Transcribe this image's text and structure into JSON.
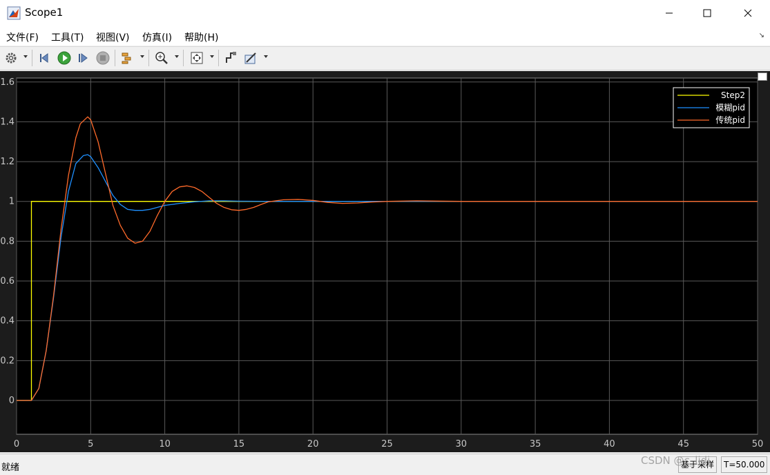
{
  "window": {
    "title": "Scope1"
  },
  "menu": {
    "items": [
      "文件(F)",
      "工具(T)",
      "视图(V)",
      "仿真(I)",
      "帮助(H)"
    ]
  },
  "toolbar": {
    "icons": [
      "gear-icon",
      "step-back-icon",
      "run-icon",
      "step-forward-icon",
      "stop-icon",
      "signal-select-icon",
      "zoom-in-icon",
      "fit-view-icon",
      "cursor-icon",
      "measure-icon"
    ]
  },
  "status": {
    "text": "就绪",
    "mode": "基于采样",
    "time": "T=50.000"
  },
  "watermark": "CSDN @c_lidi",
  "colors": {
    "plot_bg": "#000000",
    "grid": "#5a5a5a",
    "step": "#ffff00",
    "fuzzy": "#1e90ff",
    "classic": "#ff6a2a"
  },
  "chart_data": {
    "type": "line",
    "xlim": [
      0,
      50
    ],
    "ylim": [
      -0.17,
      1.62
    ],
    "xticks": [
      0,
      5,
      10,
      15,
      20,
      25,
      30,
      35,
      40,
      45,
      50
    ],
    "yticks": [
      0,
      0.2,
      0.4,
      0.6,
      0.8,
      1,
      1.2,
      1.4,
      1.6
    ],
    "xtick_labels": [
      "0",
      "5",
      "10",
      "15",
      "20",
      "25",
      "30",
      "35",
      "40",
      "45",
      "50"
    ],
    "ytick_labels": [
      "0",
      "0.2",
      "0.4",
      "0.6",
      "0.8",
      "1",
      "1.2",
      "1.4",
      "1.6"
    ],
    "grid": true,
    "legend_position": "top-right",
    "series": [
      {
        "name": "Step2",
        "color": "#ffff00",
        "x": [
          0,
          1,
          1,
          50
        ],
        "y": [
          0,
          0,
          1,
          1
        ]
      },
      {
        "name": "模糊pid",
        "color": "#1e90ff",
        "x": [
          0,
          1,
          1.5,
          2,
          2.5,
          3,
          3.5,
          4,
          4.5,
          4.8,
          5,
          5.5,
          6,
          6.5,
          7,
          7.5,
          8,
          8.5,
          9,
          10,
          11,
          12,
          13,
          14,
          15,
          17,
          20,
          25,
          30,
          40,
          50
        ],
        "y": [
          0,
          0,
          0.06,
          0.25,
          0.52,
          0.82,
          1.05,
          1.19,
          1.23,
          1.235,
          1.225,
          1.17,
          1.1,
          1.03,
          0.985,
          0.96,
          0.955,
          0.955,
          0.96,
          0.98,
          0.99,
          0.998,
          1.003,
          1.003,
          1.001,
          1.0,
          1.0,
          1.0,
          1.0,
          1.0,
          1.0
        ]
      },
      {
        "name": "传统pid",
        "color": "#ff6a2a",
        "x": [
          0,
          1,
          1.5,
          2,
          2.5,
          3,
          3.5,
          4,
          4.3,
          4.8,
          5,
          5.5,
          6,
          6.5,
          7,
          7.5,
          8,
          8.5,
          9,
          9.5,
          10,
          10.5,
          11,
          11.5,
          12,
          12.5,
          13,
          13.5,
          14,
          14.5,
          15,
          15.5,
          16,
          16.5,
          17,
          18,
          19,
          20,
          21,
          22,
          23,
          24,
          25,
          27,
          30,
          35,
          40,
          45,
          50
        ],
        "y": [
          0,
          0,
          0.06,
          0.25,
          0.53,
          0.86,
          1.13,
          1.32,
          1.39,
          1.425,
          1.41,
          1.3,
          1.14,
          0.98,
          0.88,
          0.815,
          0.79,
          0.8,
          0.85,
          0.93,
          1.0,
          1.05,
          1.073,
          1.078,
          1.07,
          1.05,
          1.02,
          0.99,
          0.97,
          0.958,
          0.955,
          0.96,
          0.97,
          0.985,
          0.998,
          1.008,
          1.01,
          1.005,
          0.995,
          0.99,
          0.992,
          0.997,
          1.0,
          1.003,
          1.0,
          1.0,
          1.0,
          1.0,
          1.0
        ]
      }
    ]
  }
}
